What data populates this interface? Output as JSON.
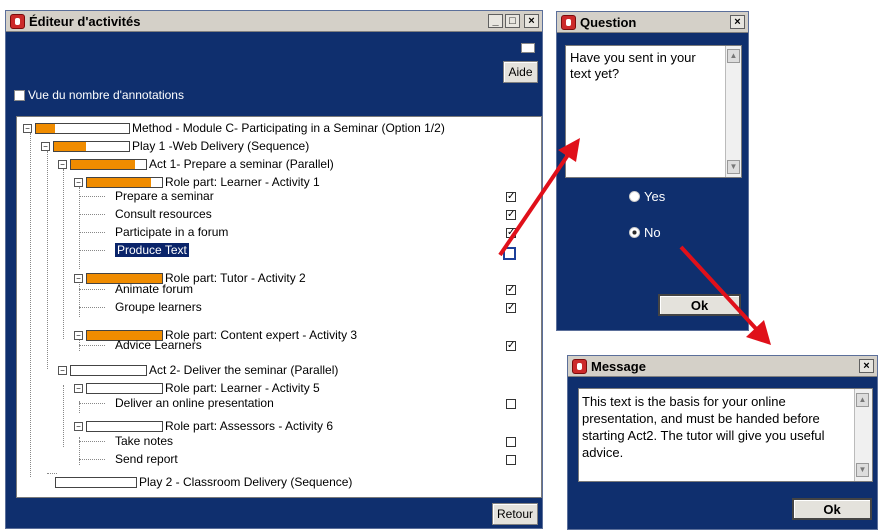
{
  "main_window": {
    "title": "Éditeur d'activités",
    "help_button": "Aide",
    "back_button": "Retour",
    "annotations_checkbox_label": "Vue du nombre d'annotations",
    "tree": {
      "method": "Method - Module C- Participating in a Seminar (Option 1/2)",
      "play1": "Play 1 -Web Delivery (Sequence)",
      "act1": "Act 1- Prepare a seminar (Parallel)",
      "role_learner1": "Role part: Learner - Activity 1",
      "learner1_items": [
        "Prepare a seminar",
        "Consult resources",
        "Participate in a forum",
        "Produce Text"
      ],
      "role_tutor2": "Role part: Tutor - Activity 2",
      "tutor2_items": [
        "Animate forum",
        "Groupe learners"
      ],
      "role_expert3": "Role part: Content expert - Activity 3",
      "expert3_items": [
        "Advice Learners"
      ],
      "act2": "Act 2- Deliver the seminar (Parallel)",
      "role_learner5": "Role part: Learner - Activity 5",
      "learner5_items": [
        "Deliver an online presentation"
      ],
      "role_assessors6": "Role part: Assessors - Activity 6",
      "assessors6_items": [
        "Take notes",
        "Send report"
      ],
      "play2": "Play 2 - Classroom Delivery (Sequence)"
    }
  },
  "question_window": {
    "title": "Question",
    "text": "Have you sent in your text yet?",
    "options": [
      "Yes",
      "No"
    ],
    "ok_button": "Ok"
  },
  "message_window": {
    "title": "Message",
    "text": "This text is the basis for your online presentation, and must be handed before starting Act2. The tutor will give you useful advice.",
    "ok_button": "Ok"
  },
  "colors": {
    "window_bg": "#0f2f6e",
    "progress_fill": "#f08c00",
    "arrow": "#e0101a"
  }
}
